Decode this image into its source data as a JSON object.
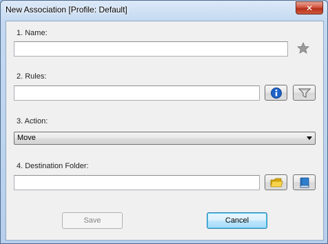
{
  "window": {
    "title": "New Association [Profile: Default]",
    "close_glyph": "✕"
  },
  "form": {
    "name": {
      "label": "1. Name:",
      "value": "",
      "favorite_icon": "star-icon"
    },
    "rules": {
      "label": "2. Rules:",
      "value": "",
      "info_icon": "info-icon",
      "filter_icon": "filter-icon"
    },
    "action": {
      "label": "3. Action:",
      "selected": "Move"
    },
    "destination": {
      "label": "4. Destination Folder:",
      "value": "",
      "browse_icon": "folder-icon",
      "library_icon": "book-icon"
    }
  },
  "buttons": {
    "save": "Save",
    "cancel": "Cancel"
  },
  "colors": {
    "accent": "#3c7fb1",
    "info": "#1e63c8",
    "folder": "#f2c21c",
    "book": "#2f7fcf"
  }
}
